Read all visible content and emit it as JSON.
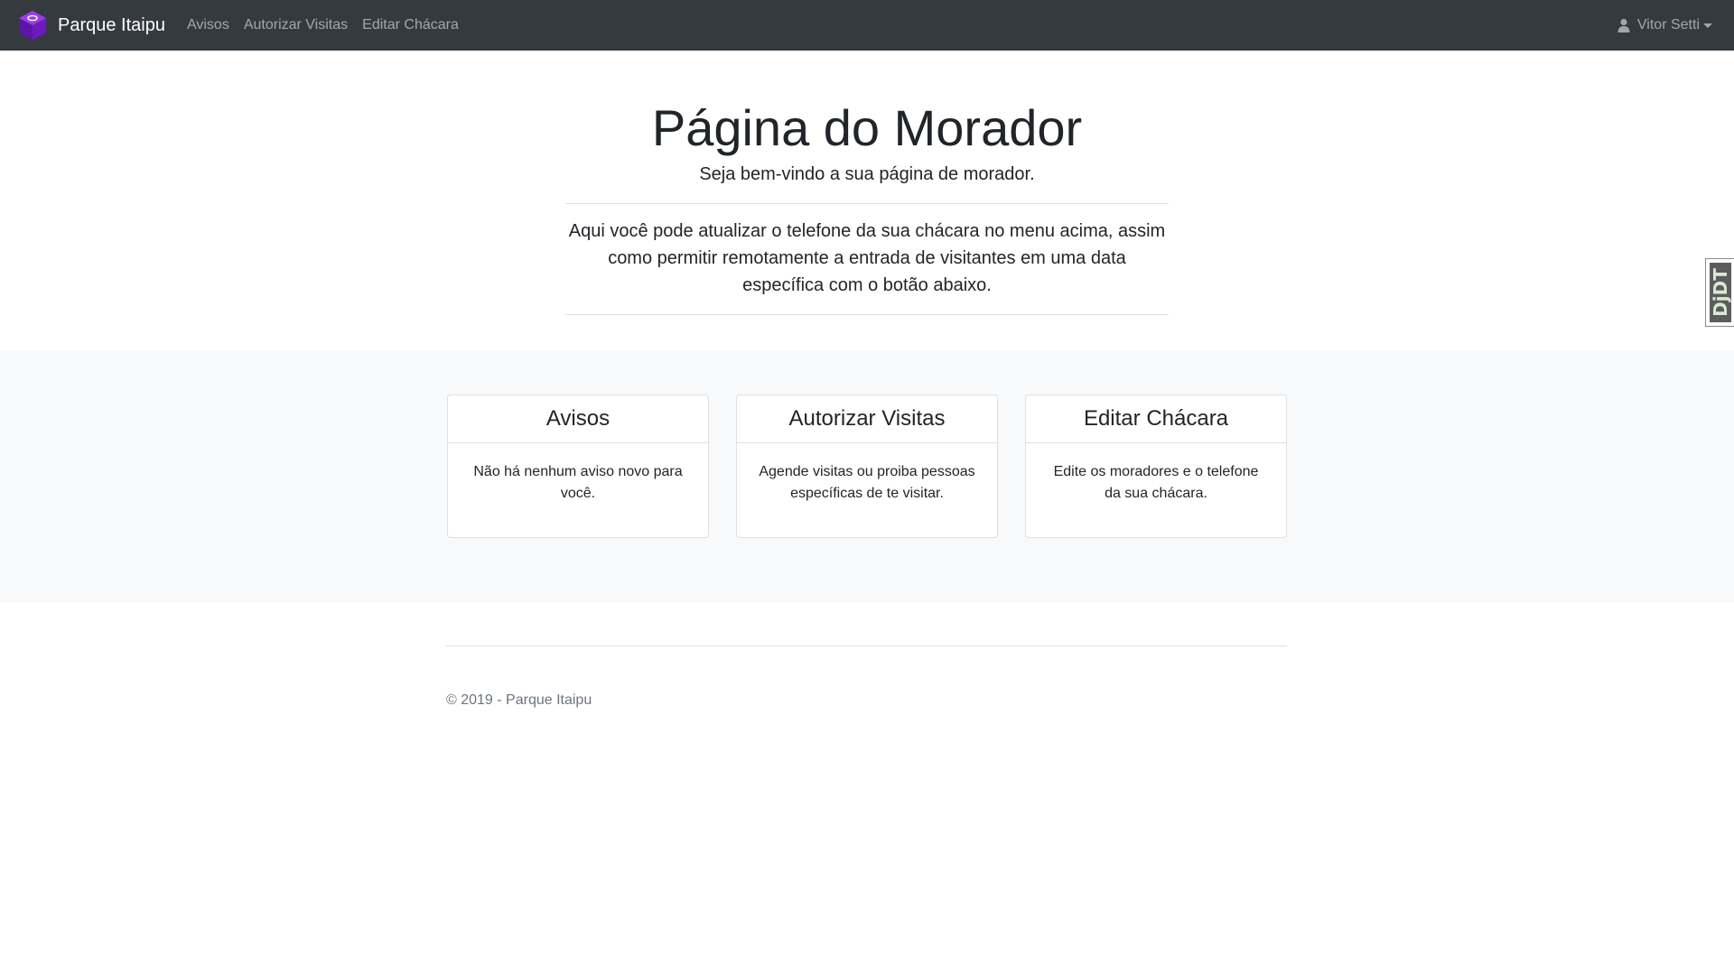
{
  "navbar": {
    "brand": "Parque Itaipu",
    "brand_icon": "cube-logo-icon",
    "brand_color": "#6f1cbf",
    "links": [
      "Avisos",
      "Autorizar Visitas",
      "Editar Chácara"
    ],
    "user": "Vitor Setti",
    "user_icon": "user-icon"
  },
  "hero": {
    "title": "Página do Morador",
    "lead": "Seja bem-vindo a sua página de morador.",
    "description": "Aqui você pode atualizar o telefone da sua chácara no menu acima, assim como permitir remotamente a entrada de visitantes em uma data específica com o botão abaixo."
  },
  "cards": [
    {
      "title": "Avisos",
      "body": "Não há nenhum aviso novo para você."
    },
    {
      "title": "Autorizar Visitas",
      "body": "Agende visitas ou proiba pessoas específicas de te visitar."
    },
    {
      "title": "Editar Chácara",
      "body": "Edite os moradores e o telefone da sua chácara."
    }
  ],
  "footer": {
    "copyright": "© 2019 - Parque Itaipu"
  },
  "side_tab": {
    "label": "DjDT"
  }
}
